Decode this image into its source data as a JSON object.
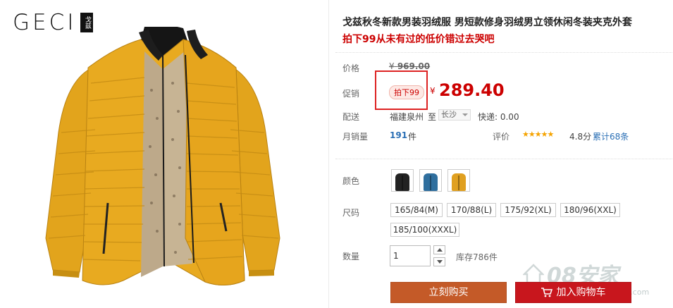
{
  "brand": {
    "logo_text": "GECI",
    "seal_text": "戈兹"
  },
  "product": {
    "title": "戈兹秋冬新款男装羽绒服 男短款修身羽绒男立领休闲冬装夹克外套",
    "subtitle": "拍下99从未有过的低价错过去哭吧"
  },
  "pricing": {
    "price_label": "价格",
    "currency": "¥",
    "original_price": "969.00",
    "promo_label": "促销",
    "promo_tag": "拍下99",
    "promo_price": "289.40"
  },
  "shipping": {
    "label": "配送",
    "from": "福建泉州",
    "to_word": "至",
    "destination": "长沙",
    "express": "快递: 0.00"
  },
  "sales": {
    "label": "月销量",
    "count": "191",
    "unit": "件",
    "rating_label": "评价",
    "stars": "★★★★★",
    "score": "4.8分",
    "review_link": "累计68条"
  },
  "options": {
    "color_label": "颜色",
    "colors": [
      {
        "name": "black-jacket",
        "hex": "#222222"
      },
      {
        "name": "blue-jacket",
        "hex": "#2f6f9e"
      },
      {
        "name": "yellow-jacket",
        "hex": "#e0a020"
      }
    ],
    "size_label": "尺码",
    "sizes": [
      "165/84(M)",
      "170/88(L)",
      "175/92(XL)",
      "180/96(XXL)",
      "185/100(XXXL)"
    ]
  },
  "quantity": {
    "label": "数量",
    "value": "1",
    "stock": "库存786件"
  },
  "actions": {
    "buy_now": "立刻购买",
    "add_to_cart": "加入购物车"
  },
  "watermark": {
    "text": "08安家",
    "sub": "home2008.com"
  },
  "colors": {
    "accent_red": "#c8161d",
    "buy_orange": "#c45a28",
    "link_blue": "#2a6fb5",
    "jacket_yellow": "#e2a41c"
  }
}
